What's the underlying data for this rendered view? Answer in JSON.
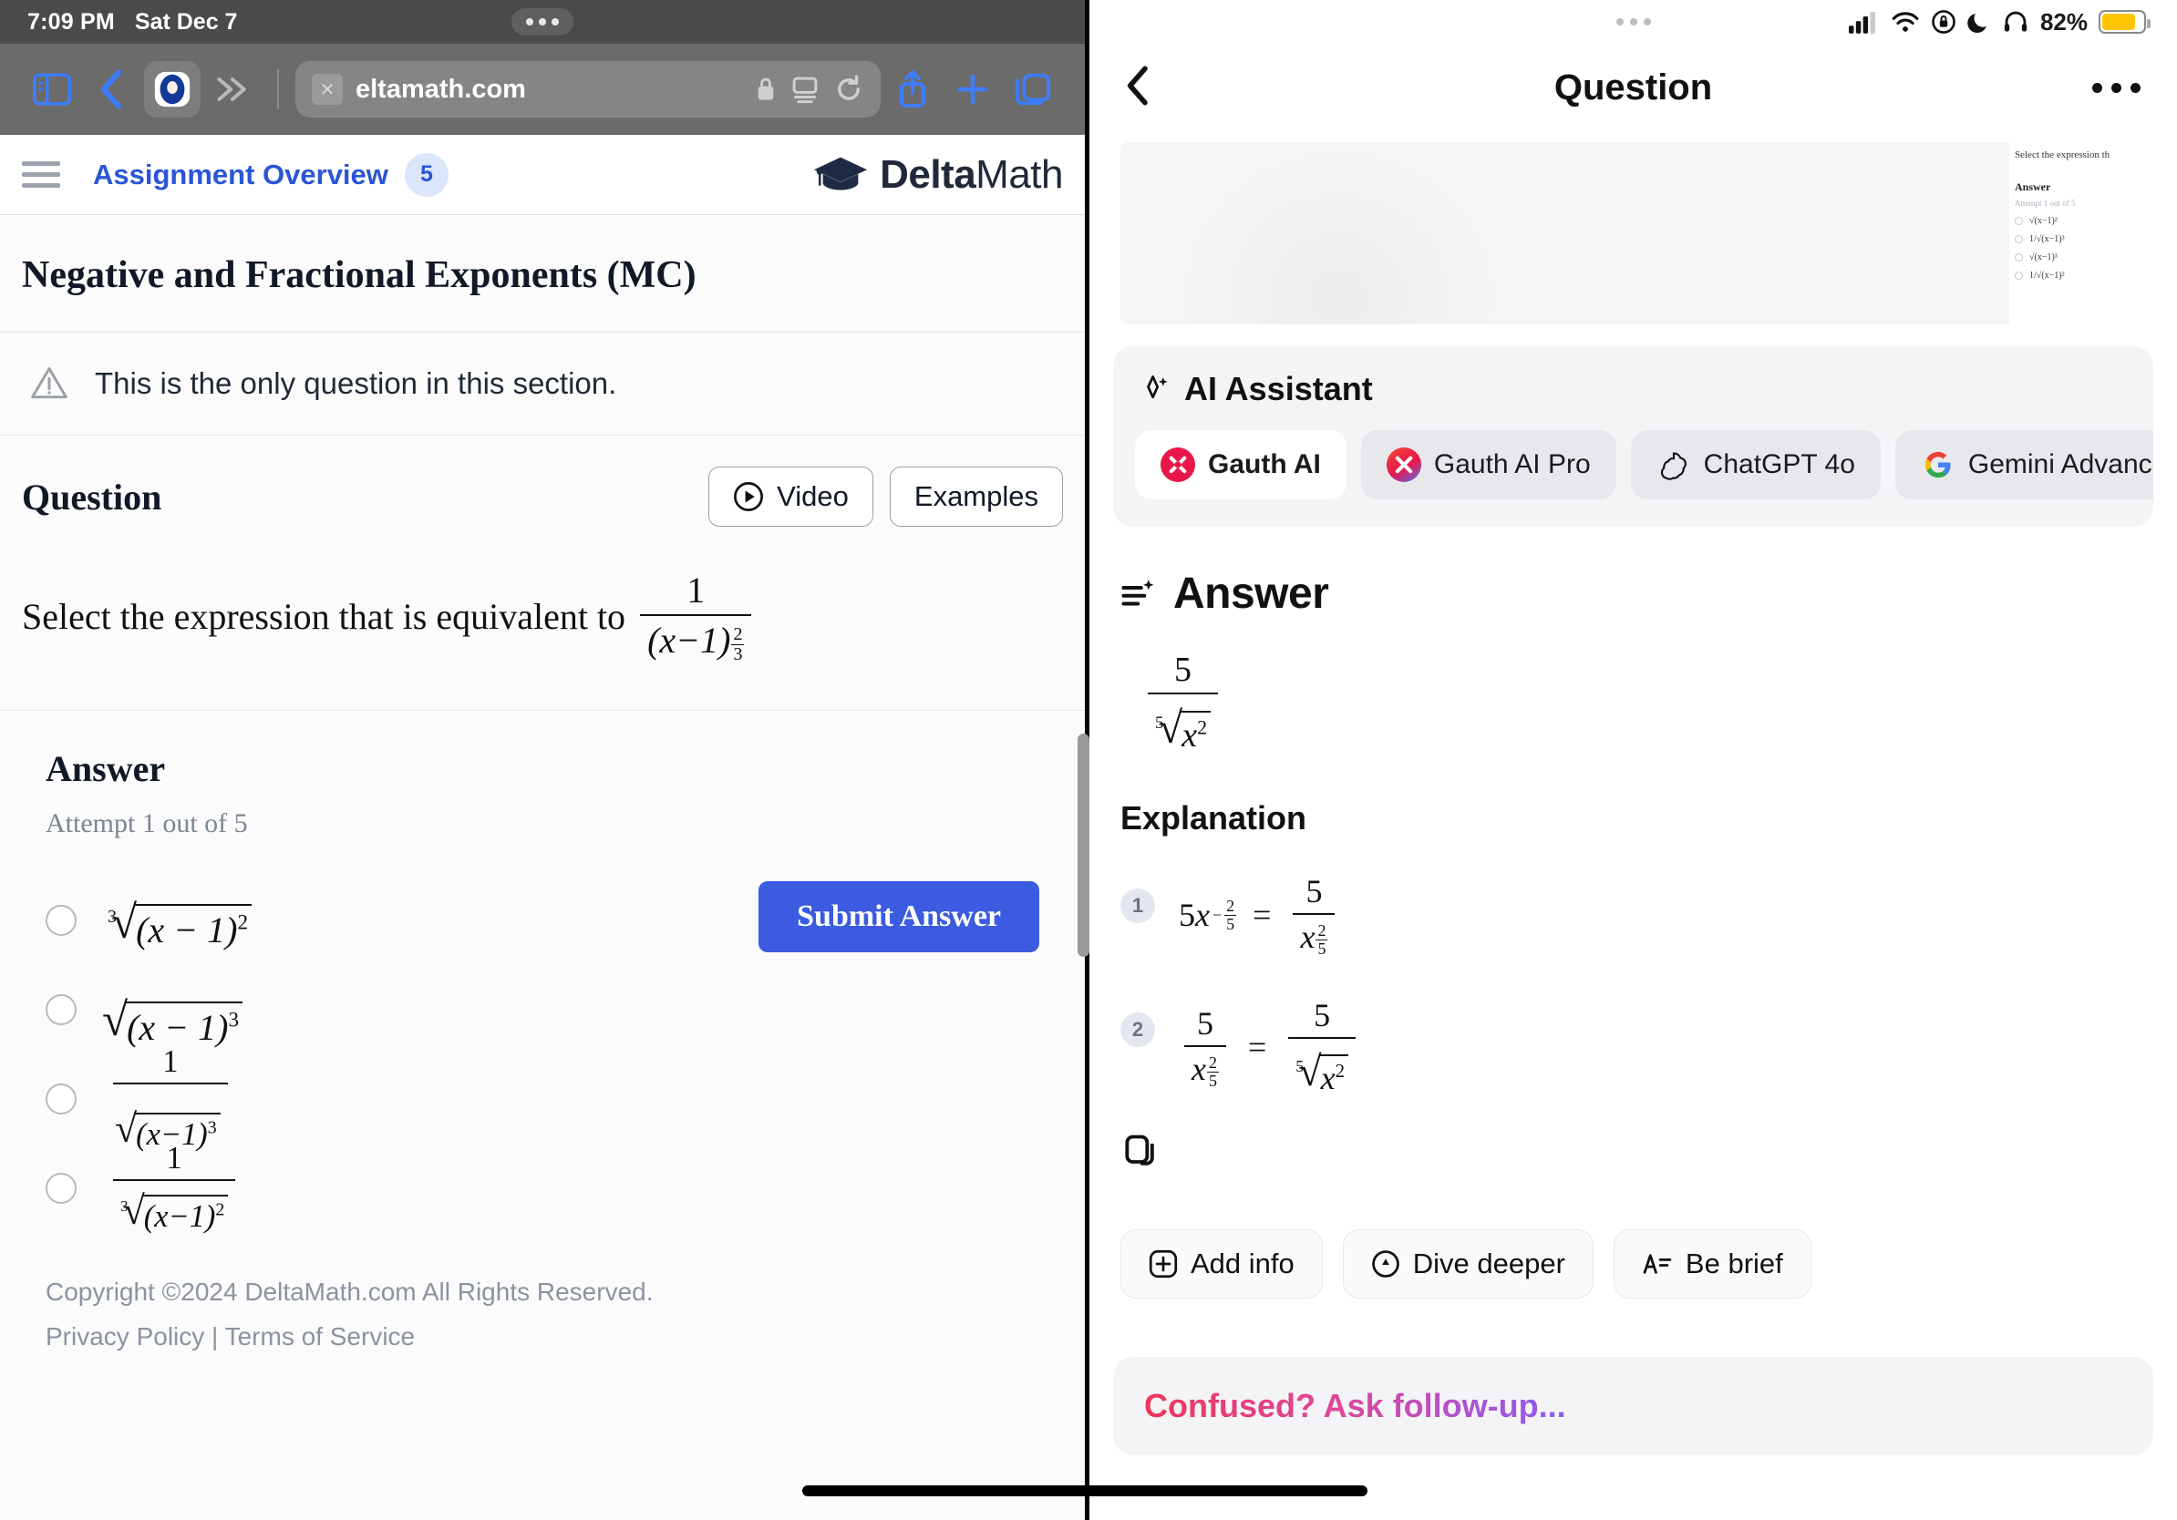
{
  "left": {
    "status_bar": {
      "time": "7:09 PM",
      "date": "Sat Dec 7"
    },
    "safari": {
      "url": "eltamath.com",
      "icons": [
        "sidebar-icon",
        "back-icon",
        "tab-group-icon",
        "forward-chevrons-icon",
        "close-tab-icon",
        "lock-icon",
        "reader-icon",
        "reload-icon",
        "share-icon",
        "new-tab-icon",
        "tabs-icon"
      ]
    },
    "site_header": {
      "nav_link": "Assignment Overview",
      "nav_badge": "5",
      "logo_bold": "Delta",
      "logo_light": "Math"
    },
    "assignment_title": "Negative and Fractional Exponents (MC)",
    "notice": "This is the only question in this section.",
    "question": {
      "label": "Question",
      "video_button": "Video",
      "examples_button": "Examples",
      "prompt_text": "Select the expression that is equivalent to",
      "prompt_math": {
        "numerator": "1",
        "base": "(x−1)",
        "exp_num": "2",
        "exp_den": "3"
      }
    },
    "answer": {
      "heading": "Answer",
      "attempt": "Attempt 1 out of 5",
      "submit_label": "Submit Answer",
      "choices": [
        {
          "id": "a",
          "latex": "\\sqrt[3]{(x-1)^2}",
          "index": "3",
          "body": "(x − 1)",
          "power": "2",
          "form": "radical"
        },
        {
          "id": "b",
          "latex": "\\sqrt{(x-1)^3}",
          "index": "",
          "body": "(x − 1)",
          "power": "3",
          "form": "radical"
        },
        {
          "id": "c",
          "latex": "\\frac{1}{\\sqrt{(x-1)^3}}",
          "index": "",
          "body": "(x−1)",
          "power": "3",
          "form": "fraction",
          "numerator": "1"
        },
        {
          "id": "d",
          "latex": "\\frac{1}{\\sqrt[3]{(x-1)^2}}",
          "index": "3",
          "body": "(x−1)",
          "power": "2",
          "form": "fraction",
          "numerator": "1"
        }
      ]
    },
    "footer": {
      "copyright": "Copyright ©2024 DeltaMath.com All Rights Reserved.",
      "privacy": "Privacy Policy",
      "separator": "|",
      "terms": "Terms of Service"
    }
  },
  "right": {
    "status_bar": {
      "battery_pct": "82%",
      "icons": [
        "cellular-signal-icon",
        "wifi-icon",
        "rotation-lock-icon",
        "do-not-disturb-moon-icon",
        "headphones-icon",
        "battery-icon"
      ]
    },
    "navbar": {
      "title": "Question",
      "back_icon": "back-chevron-icon",
      "more_icon": "more-options-icon"
    },
    "screenshot_preview": {
      "line": "Select the expression th",
      "answer_label": "Answer",
      "attempt_label": "Attempt 1 out of 5",
      "options_count": "4"
    },
    "ai_assistant": {
      "title": "AI Assistant",
      "chips": [
        {
          "label": "Gauth AI",
          "selected": true,
          "icon": "gauth-logo-icon",
          "color": "#e8174a"
        },
        {
          "label": "Gauth AI Pro",
          "selected": false,
          "icon": "gauth-pro-logo-icon",
          "color": "#f0452f"
        },
        {
          "label": "ChatGPT 4o",
          "selected": false,
          "icon": "openai-logo-icon",
          "color": "#1a1a1a"
        },
        {
          "label": "Gemini Advanced",
          "selected": false,
          "icon": "google-logo-icon",
          "color": "#4285f4"
        }
      ]
    },
    "answer_section": {
      "title": "Answer",
      "icon": "answer-list-sparkle-icon",
      "result": {
        "numerator": "5",
        "root_index": "5",
        "radicand": "x",
        "radicand_power": "2"
      }
    },
    "explanation": {
      "title": "Explanation",
      "steps": [
        {
          "num": "1",
          "lhs_coef": "5",
          "lhs_var": "x",
          "lhs_exp": "−2/5",
          "rhs_num": "5",
          "rhs_den_var": "x",
          "rhs_den_exp_n": "2",
          "rhs_den_exp_d": "5"
        },
        {
          "num": "2",
          "lhs_num": "5",
          "lhs_den_var": "x",
          "lhs_den_exp_n": "2",
          "lhs_den_exp_d": "5",
          "rhs_num": "5",
          "rhs_root_index": "5",
          "rhs_radicand": "x",
          "rhs_radicand_power": "2"
        }
      ],
      "copy_icon": "copy-icon"
    },
    "actions": [
      {
        "label": "Add info",
        "icon": "plus-circle-icon"
      },
      {
        "label": "Dive deeper",
        "icon": "arrow-down-circle-icon"
      },
      {
        "label": "Be brief",
        "icon": "text-shorten-icon"
      }
    ],
    "followup": {
      "text": "Confused? Ask follow-up...",
      "gradient_from": "#f0355a",
      "gradient_to": "#8b5cf6"
    }
  }
}
